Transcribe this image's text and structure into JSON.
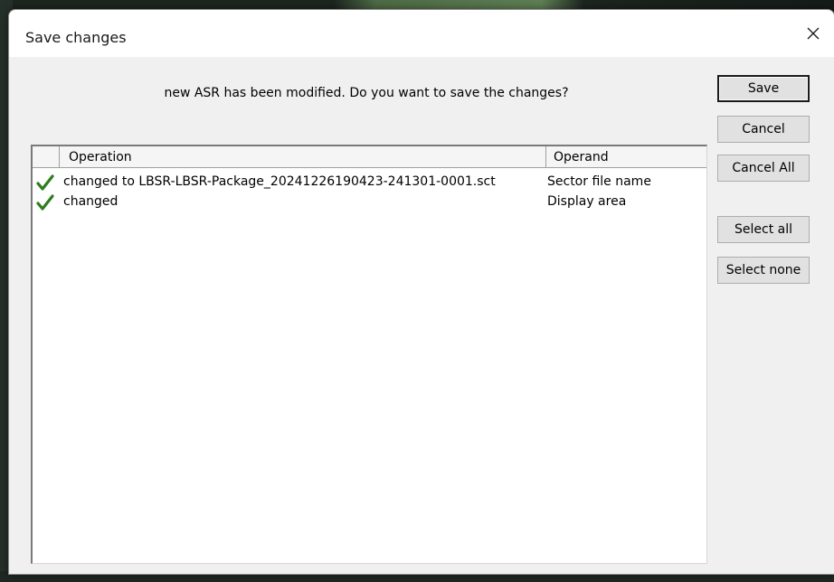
{
  "dialog": {
    "title": "Save changes",
    "message": "new ASR has been modified. Do you want to save the changes?"
  },
  "buttons": {
    "save": "Save",
    "cancel": "Cancel",
    "cancel_all": "Cancel All",
    "select_all": "Select all",
    "select_none": "Select none"
  },
  "list": {
    "columns": [
      "",
      "Operation",
      "Operand"
    ],
    "rows": [
      {
        "checked": true,
        "operation": "changed to LBSR-LBSR-Package_20241226190423-241301-0001.sct",
        "operand": "Sector file name"
      },
      {
        "checked": true,
        "operation": "changed",
        "operand": "Display area"
      }
    ]
  },
  "colors": {
    "check": "#2e7d1e"
  },
  "icons": {
    "close": "close-icon",
    "check": "check-icon"
  }
}
